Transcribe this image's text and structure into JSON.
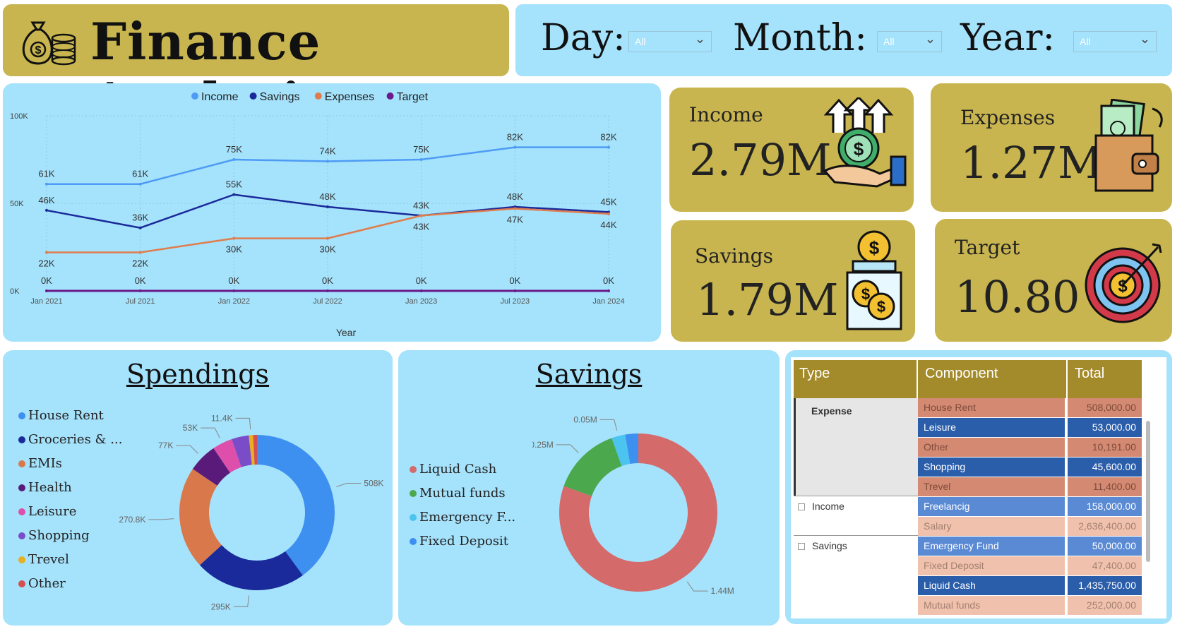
{
  "header": {
    "title": "Finance Analysis",
    "icon": "money-bag-coins-icon"
  },
  "filters": {
    "day": {
      "label": "Day:",
      "value": "All"
    },
    "month": {
      "label": "Month:",
      "value": "All"
    },
    "year": {
      "label": "Year:",
      "value": "All"
    }
  },
  "colors": {
    "gold": "#c8b54f",
    "panel_blue": "#a5e2fb",
    "income": "#4e9bf5",
    "savings": "#1a2a9a",
    "expenses": "#e07c4c",
    "target": "#6a1a8a"
  },
  "kpis": {
    "income": {
      "label": "Income",
      "value": "2.79M",
      "icon": "income-growth-coin-hand-icon"
    },
    "expenses": {
      "label": "Expenses",
      "value": "1.27M",
      "icon": "wallet-cash-icon"
    },
    "savings": {
      "label": "Savings",
      "value": "1.79M",
      "icon": "coin-jar-icon"
    },
    "target": {
      "label": "Target",
      "value": "10.80",
      "icon": "dollar-target-icon"
    }
  },
  "line_chart": {
    "legend": [
      "Income",
      "Savings",
      "Expenses",
      "Target"
    ],
    "y_ticks": [
      "100K",
      "50K",
      "0K"
    ],
    "x_ticks": [
      "Jan 2021",
      "Jul 2021",
      "Jan 2022",
      "Jul 2022",
      "Jan 2023",
      "Jul 2023",
      "Jan 2024"
    ],
    "xlabel": "Year"
  },
  "spendings": {
    "title": "Spendings",
    "legend": [
      "House Rent",
      "Groceries & ...",
      "EMIs",
      "Health",
      "Leisure",
      "Shopping",
      "Trevel",
      "Other"
    ],
    "labels": [
      "508K",
      "295K",
      "270.8K",
      "77K",
      "53K",
      "11.4K"
    ]
  },
  "savings_chart": {
    "title": "Savings",
    "legend": [
      "Liquid Cash",
      "Mutual funds",
      "Emergency F...",
      "Fixed Deposit"
    ],
    "labels": [
      "1.44M",
      "0.25M",
      "0.05M"
    ]
  },
  "table": {
    "headers": [
      "Type",
      "Component",
      "Total"
    ],
    "groups": [
      {
        "type": "Expense",
        "rows": [
          [
            "House Rent",
            "508,000.00"
          ],
          [
            "Leisure",
            "53,000.00"
          ],
          [
            "Other",
            "10,191.00"
          ],
          [
            "Shopping",
            "45,600.00"
          ],
          [
            "Trevel",
            "11,400.00"
          ]
        ]
      },
      {
        "type": "Income",
        "rows": [
          [
            "Freelancig",
            "158,000.00"
          ],
          [
            "Salary",
            "2,636,400.00"
          ]
        ]
      },
      {
        "type": "Savings",
        "rows": [
          [
            "Emergency Fund",
            "50,000.00"
          ],
          [
            "Fixed Deposit",
            "47,400.00"
          ],
          [
            "Liquid Cash",
            "1,435,750.00"
          ],
          [
            "Mutual funds",
            "252,000.00"
          ]
        ]
      }
    ]
  },
  "chart_data": [
    {
      "type": "line",
      "x": [
        "Jan 2021",
        "Jul 2021",
        "Jan 2022",
        "Jul 2022",
        "Jan 2023",
        "Jul 2023",
        "Jan 2024"
      ],
      "xlabel": "Year",
      "ylim": [
        0,
        100000
      ],
      "series": [
        {
          "name": "Income",
          "values": [
            61000,
            61000,
            75000,
            74000,
            75000,
            82000,
            82000
          ]
        },
        {
          "name": "Savings",
          "values": [
            46000,
            36000,
            55000,
            48000,
            43000,
            48000,
            45000
          ]
        },
        {
          "name": "Expenses",
          "values": [
            22000,
            22000,
            30000,
            30000,
            43000,
            47000,
            44000
          ]
        },
        {
          "name": "Target",
          "values": [
            0,
            0,
            0,
            0,
            0,
            0,
            0
          ]
        }
      ],
      "legend": "top",
      "grid": true
    },
    {
      "type": "pie",
      "title": "Spendings",
      "categories": [
        "House Rent",
        "Groceries & ...",
        "EMIs",
        "Health",
        "Leisure",
        "Shopping",
        "Trevel",
        "Other"
      ],
      "values": [
        508000,
        295000,
        270800,
        77000,
        53000,
        45600,
        11400,
        10191
      ],
      "colors": [
        "#3d8ff0",
        "#1a2a9a",
        "#d9784a",
        "#5a1a7a",
        "#dd4faa",
        "#7a4cc8",
        "#e8b020",
        "#d45050"
      ]
    },
    {
      "type": "pie",
      "title": "Savings",
      "categories": [
        "Liquid Cash",
        "Mutual funds",
        "Emergency F...",
        "Fixed Deposit"
      ],
      "values": [
        1435750,
        252000,
        50000,
        47400
      ],
      "colors": [
        "#d46a6a",
        "#4ca84c",
        "#4cc4f0",
        "#3d8ff0"
      ]
    }
  ]
}
